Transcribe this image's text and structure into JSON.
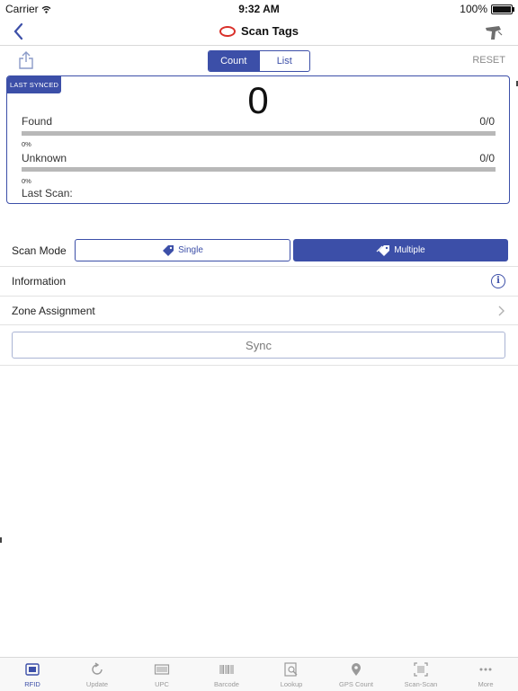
{
  "status_bar": {
    "carrier": "Carrier",
    "time": "9:32 AM",
    "battery": "100%"
  },
  "nav": {
    "title": "Scan Tags"
  },
  "toolbar": {
    "segments": [
      {
        "label": "Count",
        "selected": true
      },
      {
        "label": "List",
        "selected": false
      }
    ],
    "reset_label": "RESET"
  },
  "summary": {
    "badge": "LAST SYNCED",
    "count": "0",
    "found_label": "Found",
    "found_value": "0/0",
    "found_pct": "0%",
    "unknown_label": "Unknown",
    "unknown_value": "0/0",
    "unknown_pct": "0%",
    "last_scan_label": "Last Scan:"
  },
  "scan_mode": {
    "label": "Scan Mode",
    "single_label": "Single",
    "multiple_label": "Multiple",
    "selected": "Multiple"
  },
  "information_label": "Information",
  "zone_assignment_label": "Zone Assignment",
  "sync_label": "Sync",
  "tabs": [
    {
      "label": "RFID",
      "icon": "rfid-icon",
      "active": true
    },
    {
      "label": "Update",
      "icon": "refresh-icon",
      "active": false
    },
    {
      "label": "UPC",
      "icon": "upc-icon",
      "active": false
    },
    {
      "label": "Barcode",
      "icon": "barcode-icon",
      "active": false
    },
    {
      "label": "Lookup",
      "icon": "lookup-icon",
      "active": false
    },
    {
      "label": "GPS Count",
      "icon": "location-pin-icon",
      "active": false
    },
    {
      "label": "Scan-Scan",
      "icon": "scan-frame-icon",
      "active": false
    },
    {
      "label": "More",
      "icon": "more-dots-icon",
      "active": false
    }
  ],
  "colors": {
    "accent": "#3c4fa8",
    "brand_red": "#d9302a",
    "progress_track": "#b8b8b8"
  }
}
